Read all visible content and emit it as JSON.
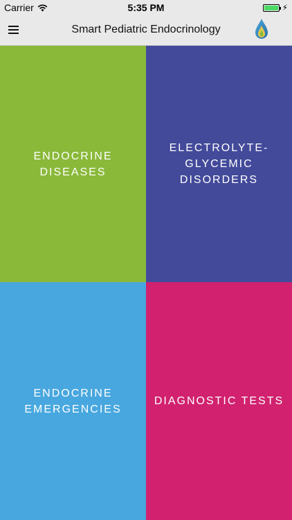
{
  "status_bar": {
    "carrier": "Carrier",
    "time": "5:35 PM",
    "battery_level": 1.0
  },
  "nav": {
    "title": "Smart Pediatric Endocrinology",
    "menu_icon": "hamburger-menu-icon",
    "logo_icon": "drop-logo-icon"
  },
  "tiles": [
    {
      "label": "ENDOCRINE\nDISEASES",
      "color": "#8ab93a"
    },
    {
      "label": "ELECTROLYTE-\nGLYCEMIC\nDISORDERS",
      "color": "#434a9a"
    },
    {
      "label": "ENDOCRINE\nEMERGENCIES",
      "color": "#48a7df"
    },
    {
      "label": "DIAGNOSTIC TESTS",
      "color": "#d1216f"
    }
  ]
}
